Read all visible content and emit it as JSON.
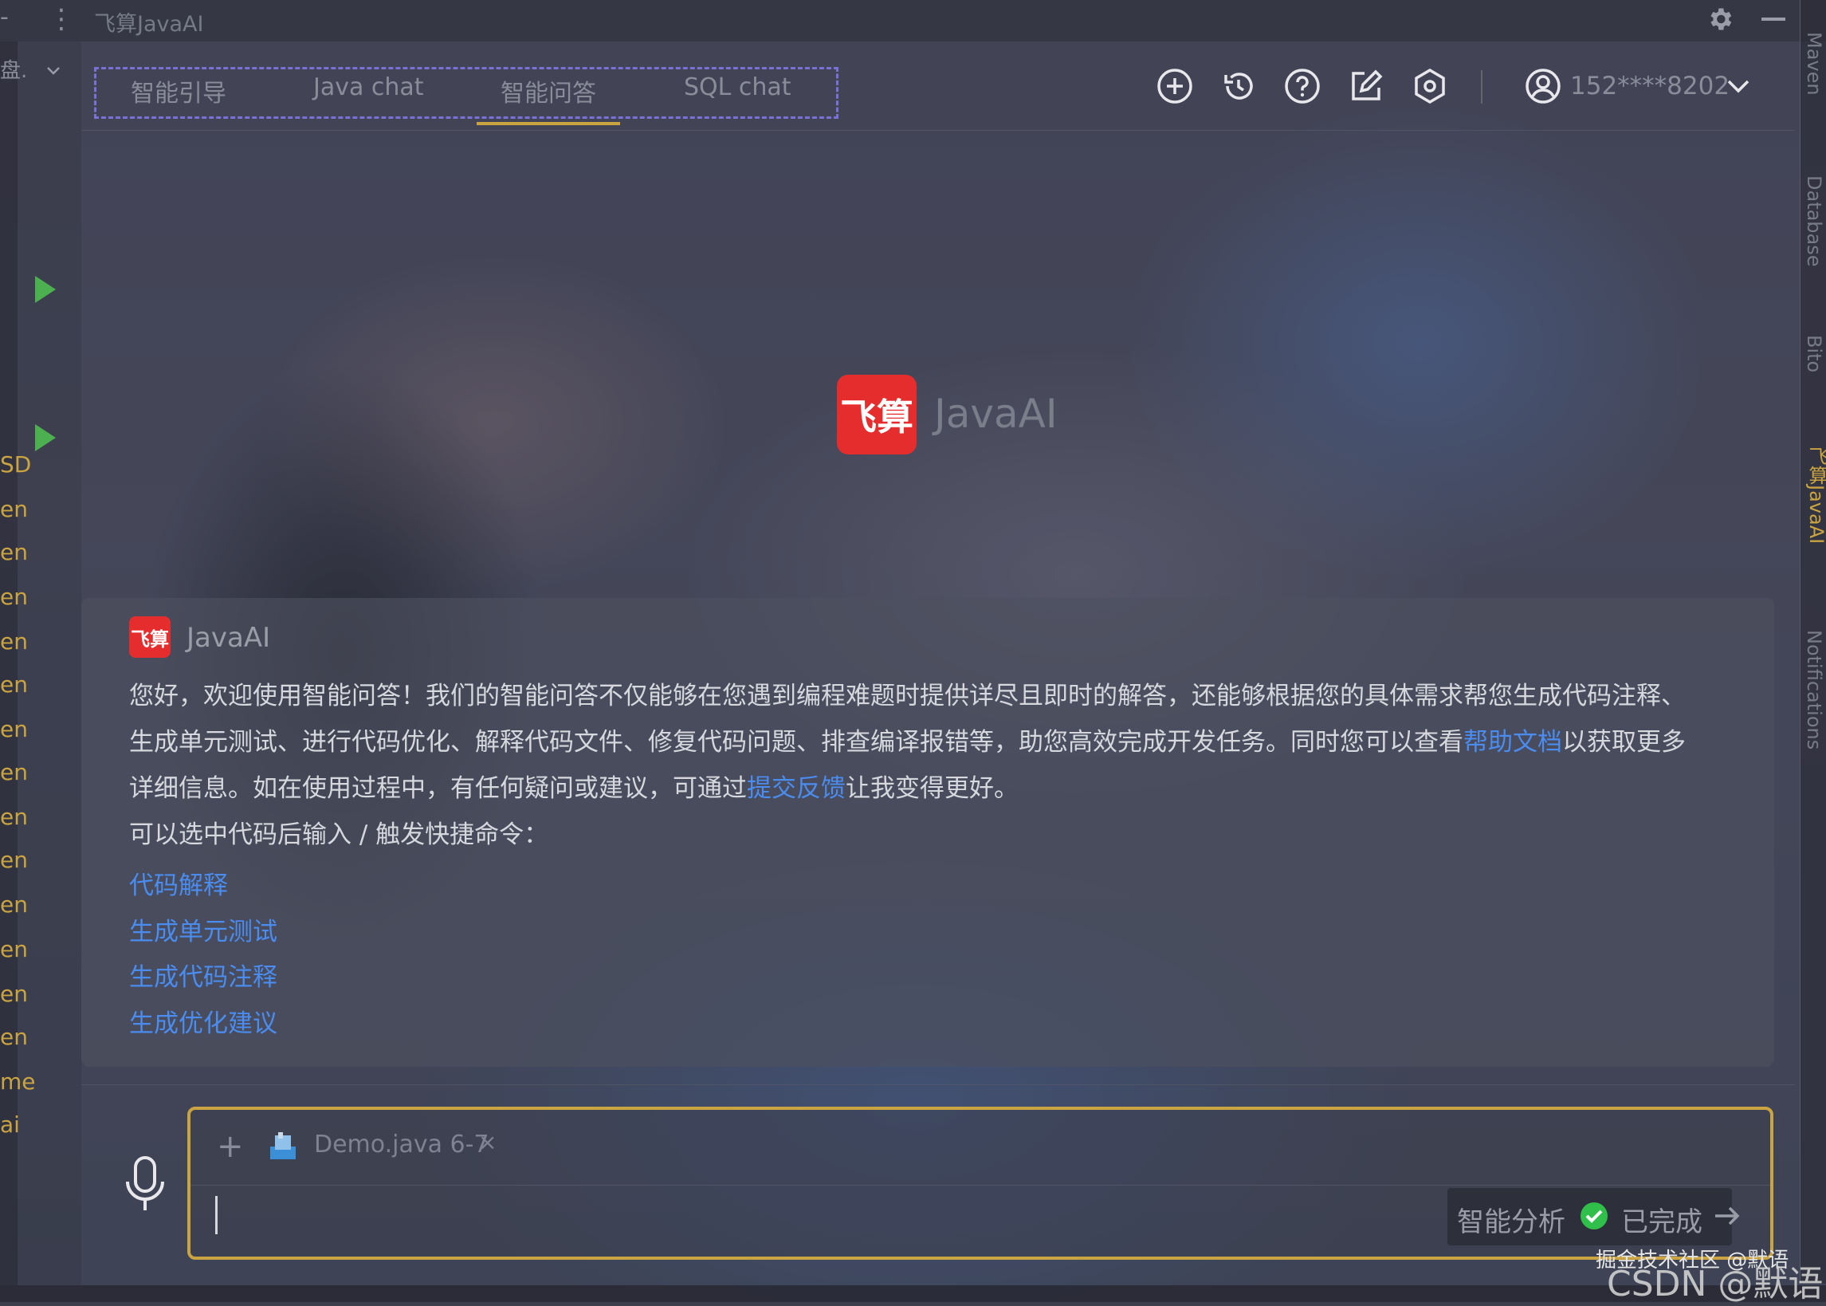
{
  "window": {
    "title": "飞算JavaAI"
  },
  "tabs": [
    {
      "label": "智能引导"
    },
    {
      "label": "Java chat"
    },
    {
      "label": "智能问答"
    },
    {
      "label": "SQL chat"
    }
  ],
  "active_tab": "智能问答",
  "header_icons": [
    "plus-circle-icon",
    "history-icon",
    "help-icon",
    "edit-icon",
    "settings-hex-icon"
  ],
  "account": {
    "label": "152****8202"
  },
  "logo": {
    "badge": "飞算",
    "name": "JavaAI"
  },
  "message": {
    "sender": "JavaAI",
    "p1a": "您好，欢迎使用智能问答！我们的智能问答不仅能够在您遇到编程难题时提供详尽且即时的解答，还能够根据您的具体需求帮您生成代码注释、",
    "p1b_pre": "生成单元测试、进行代码优化、解释代码文件、修复代码问题、排查编译报错等，助您高效完成开发任务。同时您可以查看",
    "p1b_link": "帮助文档",
    "p1b_post": "以获取更多",
    "p1c_pre": "详细信息。如在使用过程中，有任何疑问或建议，可通过",
    "p1c_link": "提交反馈",
    "p1c_post": "让我变得更好。",
    "p2": "可以选中代码后输入 / 触发快捷命令：",
    "commands": [
      "代码解释",
      "生成单元测试",
      "生成代码注释",
      "生成优化建议"
    ]
  },
  "input": {
    "attachment": "Demo.java 6-7",
    "close": "×",
    "add": "+"
  },
  "status": {
    "label": "智能分析",
    "state": "已完成"
  },
  "right_tools": [
    "Maven",
    "Database",
    "Bito",
    "飞算JavaAI",
    "Notifications"
  ],
  "watermark": {
    "line1": "掘金技术社区 @默语",
    "line2": "CSDN @默语"
  },
  "colors": {
    "accent": "#c9a440",
    "link": "#4a8cf0",
    "brand": "#e62d2d",
    "tab_border": "#7a70d6",
    "success": "#2fbf4a"
  }
}
